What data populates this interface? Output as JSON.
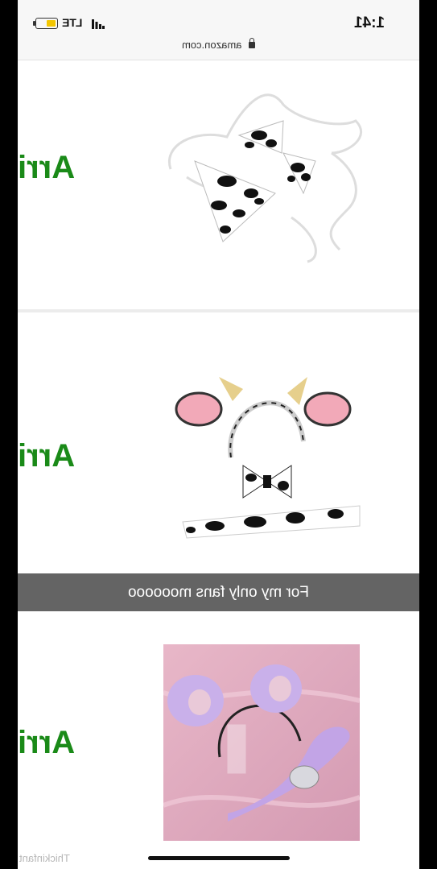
{
  "status_bar": {
    "time": "1:41",
    "network": "LTE",
    "url": "amazon.com"
  },
  "products": [
    {
      "arrival_label": "Arri",
      "item": "cow print bikini"
    },
    {
      "arrival_label": "Arri",
      "item": "cow ears headband, bow tie and tail"
    },
    {
      "arrival_label": "Arri",
      "item": "purple fur ears and tail"
    }
  ],
  "caption": "For my only fans moooooo",
  "watermark": "Thickinfant",
  "colors": {
    "arrival_green": "#1a8a18",
    "caption_bg": "#282828",
    "pink_bg": "#e8b7c8",
    "purple_fur": "#c9b0ea"
  }
}
